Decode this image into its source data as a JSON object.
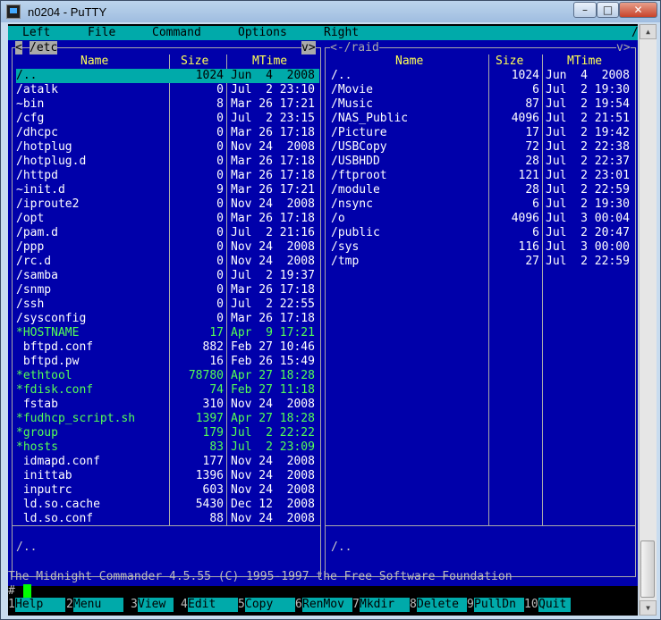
{
  "window": {
    "title": "n0204 - PuTTY",
    "min_glyph": "–",
    "max_glyph": "□",
    "close_glyph": "✕"
  },
  "menu": [
    "Left",
    "File",
    "Command",
    "Options",
    "Right"
  ],
  "menu_right_glyph": "/",
  "left_panel": {
    "path_bar": "/etc",
    "prev_glyph": "<",
    "next_glyph": "v>",
    "headers": {
      "name": "Name",
      "size": "Size",
      "mtime": "MTime"
    },
    "footer": "/..",
    "files": [
      {
        "name": "/..",
        "size": "1024",
        "mtime": "Jun  4  2008",
        "selected": true
      },
      {
        "name": "/atalk",
        "size": "0",
        "mtime": "Jul  2 23:10"
      },
      {
        "name": "~bin",
        "size": "8",
        "mtime": "Mar 26 17:21"
      },
      {
        "name": "/cfg",
        "size": "0",
        "mtime": "Jul  2 23:15"
      },
      {
        "name": "/dhcpc",
        "size": "0",
        "mtime": "Mar 26 17:18"
      },
      {
        "name": "/hotplug",
        "size": "0",
        "mtime": "Nov 24  2008"
      },
      {
        "name": "/hotplug.d",
        "size": "0",
        "mtime": "Mar 26 17:18"
      },
      {
        "name": "/httpd",
        "size": "0",
        "mtime": "Mar 26 17:18"
      },
      {
        "name": "~init.d",
        "size": "9",
        "mtime": "Mar 26 17:21"
      },
      {
        "name": "/iproute2",
        "size": "0",
        "mtime": "Nov 24  2008"
      },
      {
        "name": "/opt",
        "size": "0",
        "mtime": "Mar 26 17:18"
      },
      {
        "name": "/pam.d",
        "size": "0",
        "mtime": "Jul  2 21:16"
      },
      {
        "name": "/ppp",
        "size": "0",
        "mtime": "Nov 24  2008"
      },
      {
        "name": "/rc.d",
        "size": "0",
        "mtime": "Nov 24  2008"
      },
      {
        "name": "/samba",
        "size": "0",
        "mtime": "Jul  2 19:37"
      },
      {
        "name": "/snmp",
        "size": "0",
        "mtime": "Mar 26 17:18"
      },
      {
        "name": "/ssh",
        "size": "0",
        "mtime": "Jul  2 22:55"
      },
      {
        "name": "/sysconfig",
        "size": "0",
        "mtime": "Mar 26 17:18"
      },
      {
        "name": "*HOSTNAME",
        "size": "17",
        "mtime": "Apr  9 17:21",
        "exec": true
      },
      {
        "name": " bftpd.conf",
        "size": "882",
        "mtime": "Feb 27 10:46"
      },
      {
        "name": " bftpd.pw",
        "size": "16",
        "mtime": "Feb 26 15:49"
      },
      {
        "name": "*ethtool",
        "size": "78780",
        "mtime": "Apr 27 18:28",
        "exec": true
      },
      {
        "name": "*fdisk.conf",
        "size": "74",
        "mtime": "Feb 27 11:18",
        "exec": true
      },
      {
        "name": " fstab",
        "size": "310",
        "mtime": "Nov 24  2008"
      },
      {
        "name": "*fudhcp_script.sh",
        "size": "1397",
        "mtime": "Apr 27 18:28",
        "exec": true
      },
      {
        "name": "*group",
        "size": "179",
        "mtime": "Jul  2 22:22",
        "exec": true
      },
      {
        "name": "*hosts",
        "size": "83",
        "mtime": "Jul  2 23:09",
        "exec": true
      },
      {
        "name": " idmapd.conf",
        "size": "177",
        "mtime": "Nov 24  2008"
      },
      {
        "name": " inittab",
        "size": "1396",
        "mtime": "Nov 24  2008"
      },
      {
        "name": " inputrc",
        "size": "603",
        "mtime": "Nov 24  2008"
      },
      {
        "name": " ld.so.cache",
        "size": "5430",
        "mtime": "Dec 12  2008"
      },
      {
        "name": " ld.so.conf",
        "size": "88",
        "mtime": "Nov 24  2008"
      }
    ]
  },
  "right_panel": {
    "path_bar": "<-/raid",
    "next_glyph": "v>",
    "headers": {
      "name": "Name",
      "size": "Size",
      "mtime": "MTime"
    },
    "footer": "/..",
    "files": [
      {
        "name": "/..",
        "size": "1024",
        "mtime": "Jun  4  2008"
      },
      {
        "name": "/Movie",
        "size": "6",
        "mtime": "Jul  2 19:30"
      },
      {
        "name": "/Music",
        "size": "87",
        "mtime": "Jul  2 19:54"
      },
      {
        "name": "/NAS_Public",
        "size": "4096",
        "mtime": "Jul  2 21:51"
      },
      {
        "name": "/Picture",
        "size": "17",
        "mtime": "Jul  2 19:42"
      },
      {
        "name": "/USBCopy",
        "size": "72",
        "mtime": "Jul  2 22:38"
      },
      {
        "name": "/USBHDD",
        "size": "28",
        "mtime": "Jul  2 22:37"
      },
      {
        "name": "/ftproot",
        "size": "121",
        "mtime": "Jul  2 23:01"
      },
      {
        "name": "/module",
        "size": "28",
        "mtime": "Jul  2 22:59"
      },
      {
        "name": "/nsync",
        "size": "6",
        "mtime": "Jul  2 19:30"
      },
      {
        "name": "/o",
        "size": "4096",
        "mtime": "Jul  3 00:04"
      },
      {
        "name": "/public",
        "size": "6",
        "mtime": "Jul  2 20:47"
      },
      {
        "name": "/sys",
        "size": "116",
        "mtime": "Jul  3 00:00"
      },
      {
        "name": "/tmp",
        "size": "27",
        "mtime": "Jul  2 22:59"
      }
    ]
  },
  "status_line": "The Midnight Commander 4.5.55 (C) 1995-1997 the Free Software Foundation",
  "prompt": "#",
  "function_keys": [
    {
      "num": "1",
      "label": "Help"
    },
    {
      "num": "2",
      "label": "Menu"
    },
    {
      "num": "3",
      "label": "View"
    },
    {
      "num": "4",
      "label": "Edit"
    },
    {
      "num": "5",
      "label": "Copy"
    },
    {
      "num": "6",
      "label": "RenMov"
    },
    {
      "num": "7",
      "label": "Mkdir"
    },
    {
      "num": "8",
      "label": "Delete"
    },
    {
      "num": "9",
      "label": "PullDn"
    },
    {
      "num": "10",
      "label": "Quit"
    }
  ],
  "colors": {
    "panel_bg": "#0000aa",
    "bar_cyan": "#00aaaa",
    "header_yellow": "#ffff55",
    "exec_green": "#55ff55"
  }
}
